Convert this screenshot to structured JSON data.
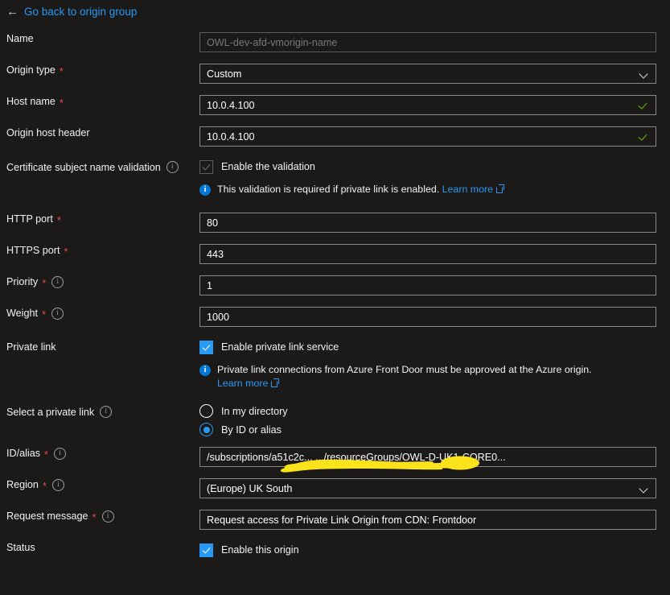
{
  "back_link": {
    "label": "Go back to origin group",
    "icon": "arrow-left-icon"
  },
  "colors": {
    "background": "#1b1a19",
    "link": "#2899f5",
    "accent": "#0078d4",
    "required_asterisk": "#e74856",
    "valid_tick": "#6bb700",
    "redaction": "#fbe31c"
  },
  "form": {
    "name": {
      "label": "Name",
      "placeholder": "OWL-dev-afd-vmorigin-name",
      "value": ""
    },
    "origin_type": {
      "label": "Origin type",
      "required": true,
      "value": "Custom"
    },
    "host_name": {
      "label": "Host name",
      "required": true,
      "value": "10.0.4.100",
      "validated": true
    },
    "origin_host_header": {
      "label": "Origin host header",
      "required": false,
      "value": "10.0.4.100",
      "validated": true
    },
    "cert_validation": {
      "label": "Certificate subject name validation",
      "checkbox_label": "Enable the validation",
      "checked": true,
      "disabled": true,
      "note": "This validation is required if private link is enabled.",
      "note_link": "Learn more"
    },
    "http_port": {
      "label": "HTTP port",
      "required": true,
      "value": "80"
    },
    "https_port": {
      "label": "HTTPS port",
      "required": true,
      "value": "443"
    },
    "priority": {
      "label": "Priority",
      "required": true,
      "value": "1"
    },
    "weight": {
      "label": "Weight",
      "required": true,
      "value": "1000"
    },
    "private_link": {
      "label": "Private link",
      "checkbox_label": "Enable private link service",
      "checked": true,
      "note": "Private link connections from Azure Front Door must be approved at the Azure origin.",
      "note_link": "Learn more"
    },
    "select_private_link": {
      "label": "Select a private link",
      "options": [
        "In my directory",
        "By ID or alias"
      ],
      "selected": "By ID or alias"
    },
    "id_alias": {
      "label": "ID/alias",
      "required": true,
      "value": "/subscriptions/a51c2c...                    .../resourceGroups/OWL-D-UK1-CORE0..."
    },
    "region": {
      "label": "Region",
      "required": true,
      "value": "(Europe) UK South"
    },
    "request_message": {
      "label": "Request message",
      "required": true,
      "value": "Request access for Private Link Origin from CDN: Frontdoor"
    },
    "status": {
      "label": "Status",
      "checkbox_label": "Enable this origin",
      "checked": true
    }
  }
}
